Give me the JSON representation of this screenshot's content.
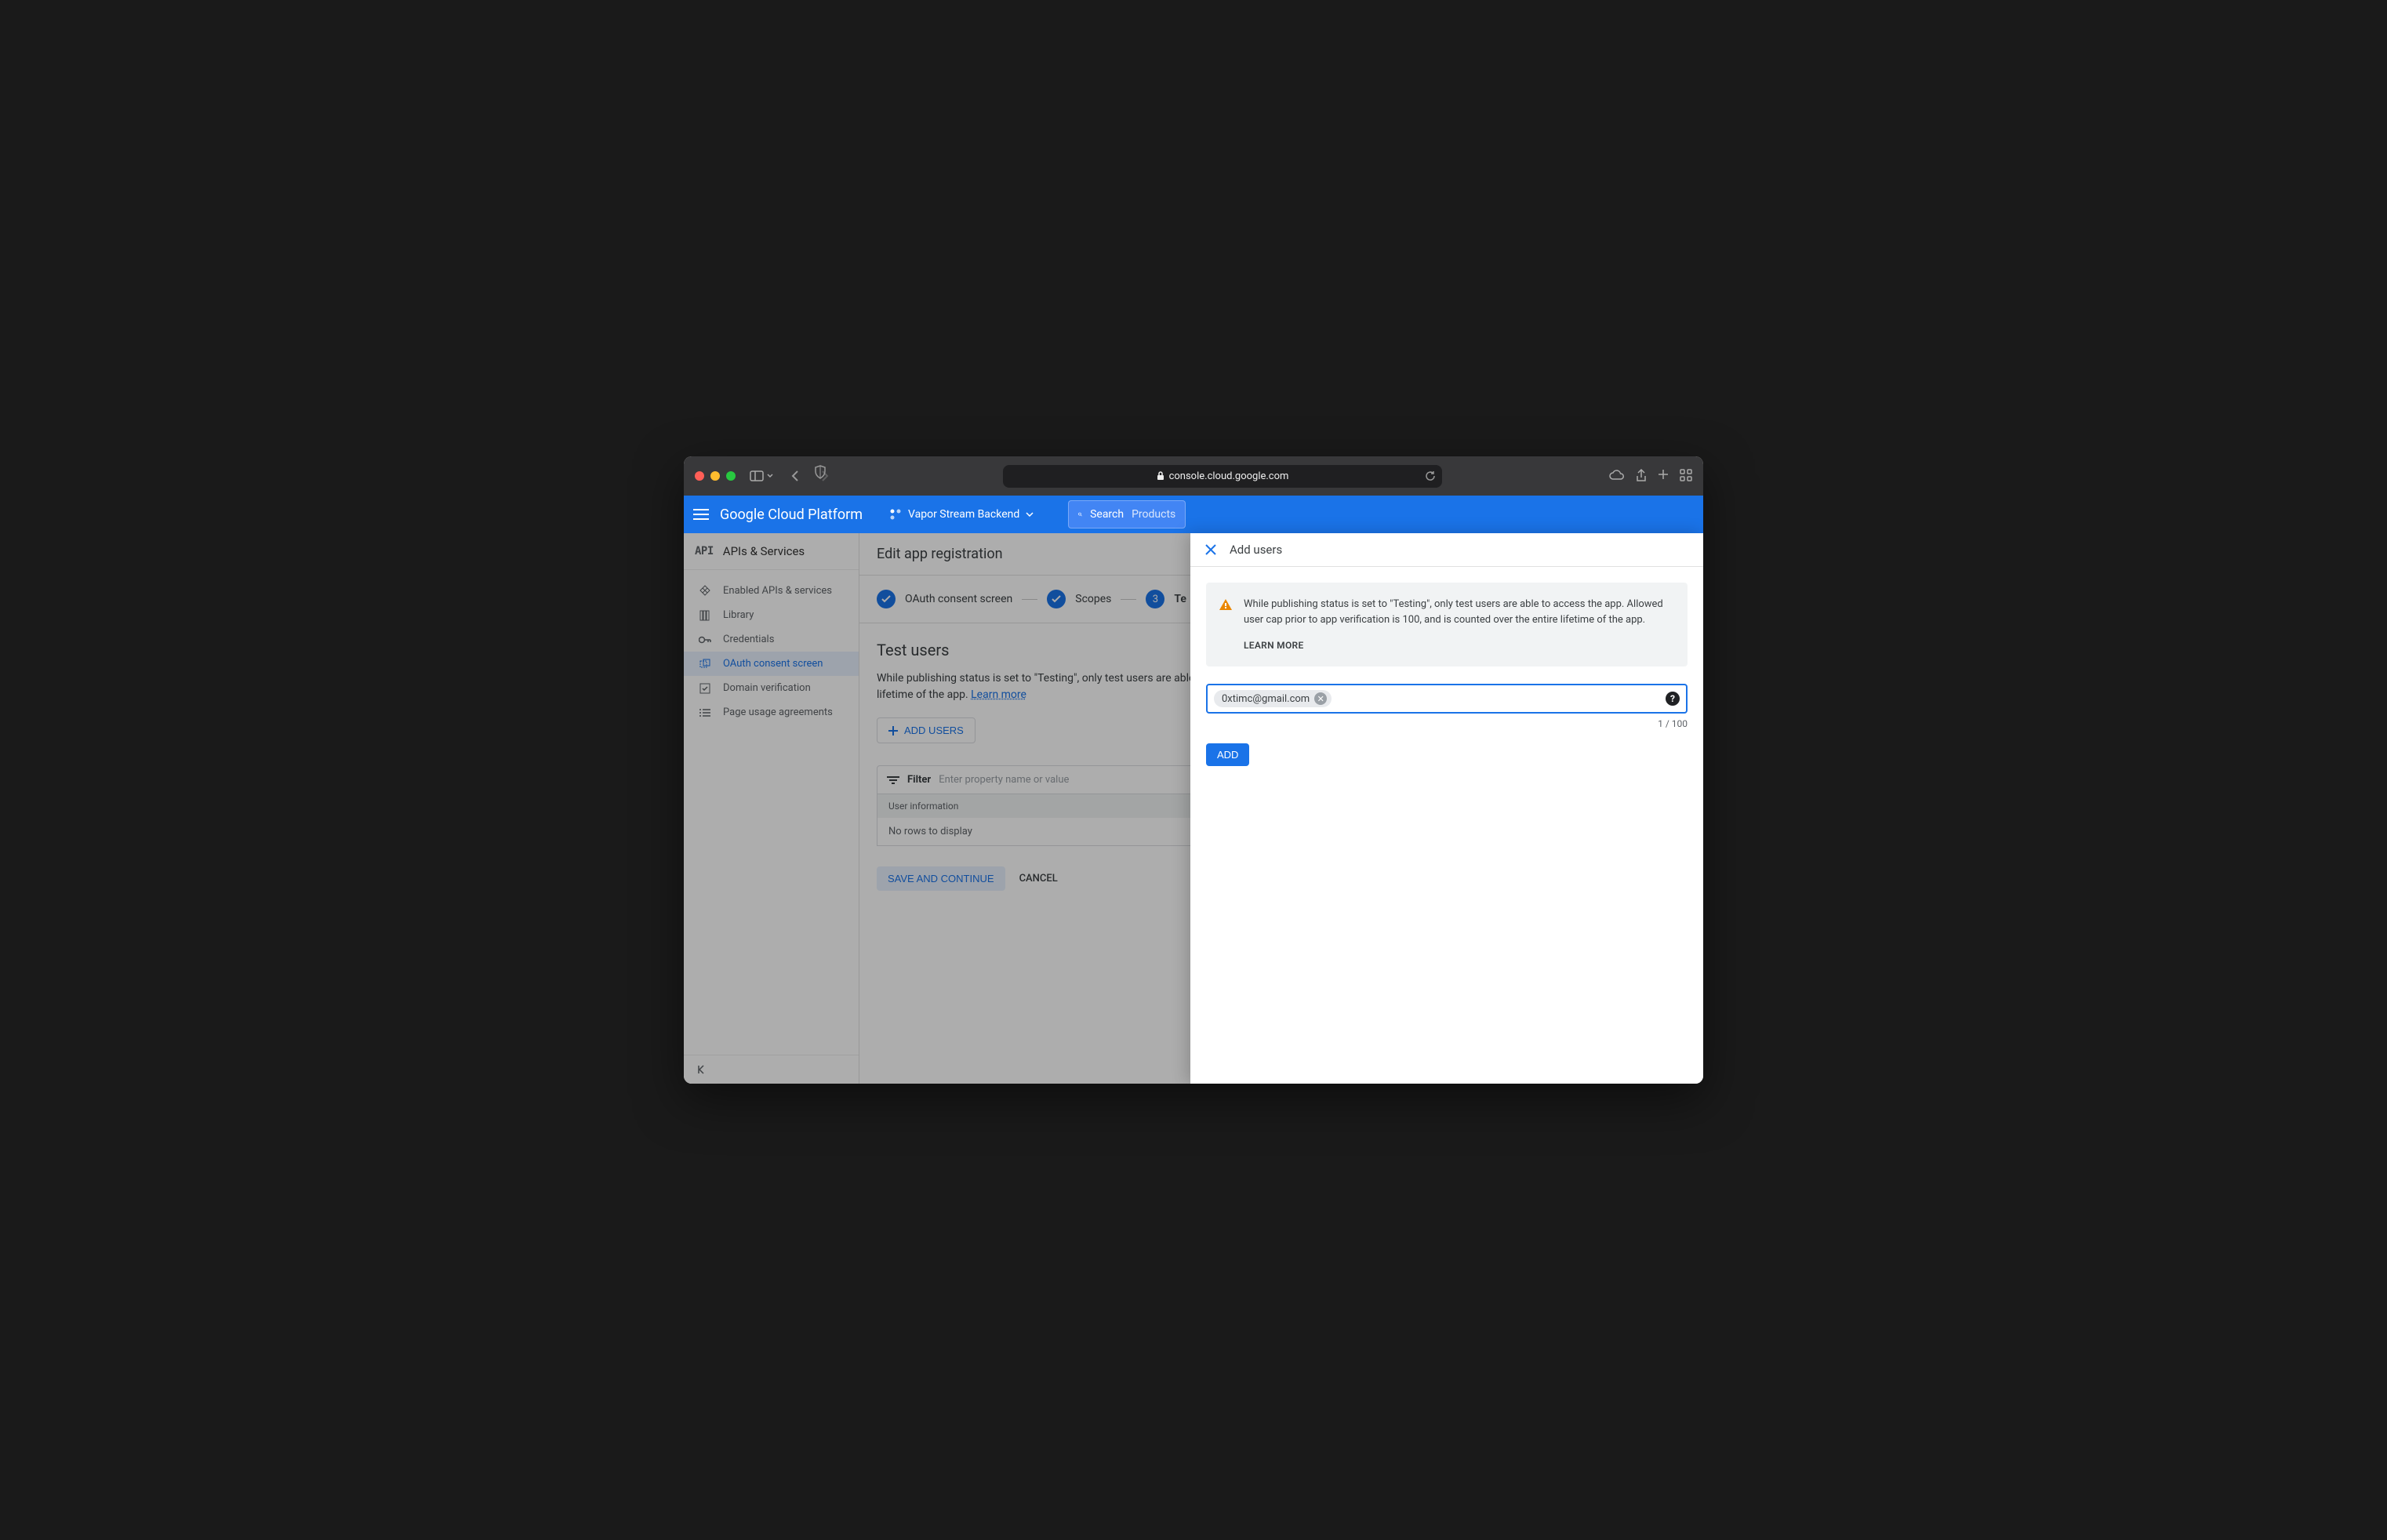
{
  "browser": {
    "url": "console.cloud.google.com"
  },
  "header": {
    "brand": "Google Cloud Platform",
    "project": "Vapor Stream Backend",
    "search_label": "Search",
    "search_placeholder": "Products"
  },
  "sidebar": {
    "title": "APIs & Services",
    "items": [
      {
        "label": "Enabled APIs & services"
      },
      {
        "label": "Library"
      },
      {
        "label": "Credentials"
      },
      {
        "label": "OAuth consent screen"
      },
      {
        "label": "Domain verification"
      },
      {
        "label": "Page usage agreements"
      }
    ],
    "active_index": 3
  },
  "main": {
    "page_title": "Edit app registration",
    "stepper": {
      "step1": "OAuth consent screen",
      "step2": "Scopes",
      "step3_number": "3",
      "step3": "Te"
    },
    "section_title": "Test users",
    "body_text": "While publishing status is set to \"Testing\", only test users are able to access the app. Allowed user cap prior to app verification is 100, and is counted over the entire lifetime of the app.",
    "learn_more": "Learn more",
    "add_users_btn": "ADD USERS",
    "filter_label": "Filter",
    "filter_placeholder": "Enter property name or value",
    "table_header": "User information",
    "table_empty": "No rows to display",
    "save_btn": "SAVE AND CONTINUE",
    "cancel_btn": "CANCEL"
  },
  "drawer": {
    "title": "Add users",
    "info_text": "While publishing status is set to \"Testing\", only test users are able to access the app. Allowed user cap prior to app verification is 100, and is counted over the entire lifetime of the app.",
    "learn_more_label": "LEARN MORE",
    "chip_email": "0xtimc@gmail.com",
    "counter": "1 / 100",
    "add_btn": "ADD"
  }
}
